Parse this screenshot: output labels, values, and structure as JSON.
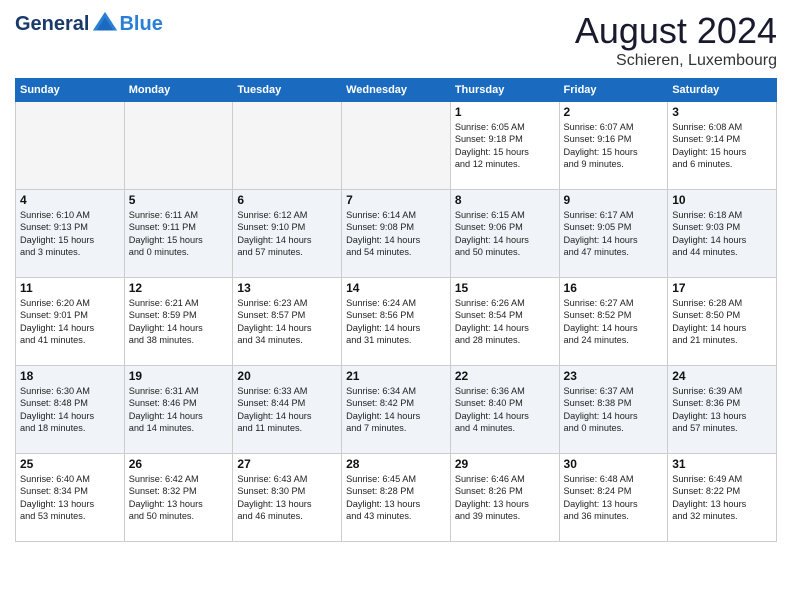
{
  "header": {
    "logo_general": "General",
    "logo_blue": "Blue",
    "main_title": "August 2024",
    "subtitle": "Schieren, Luxembourg"
  },
  "days_of_week": [
    "Sunday",
    "Monday",
    "Tuesday",
    "Wednesday",
    "Thursday",
    "Friday",
    "Saturday"
  ],
  "weeks": [
    [
      {
        "day": "",
        "info": ""
      },
      {
        "day": "",
        "info": ""
      },
      {
        "day": "",
        "info": ""
      },
      {
        "day": "",
        "info": ""
      },
      {
        "day": "1",
        "info": "Sunrise: 6:05 AM\nSunset: 9:18 PM\nDaylight: 15 hours\nand 12 minutes."
      },
      {
        "day": "2",
        "info": "Sunrise: 6:07 AM\nSunset: 9:16 PM\nDaylight: 15 hours\nand 9 minutes."
      },
      {
        "day": "3",
        "info": "Sunrise: 6:08 AM\nSunset: 9:14 PM\nDaylight: 15 hours\nand 6 minutes."
      }
    ],
    [
      {
        "day": "4",
        "info": "Sunrise: 6:10 AM\nSunset: 9:13 PM\nDaylight: 15 hours\nand 3 minutes."
      },
      {
        "day": "5",
        "info": "Sunrise: 6:11 AM\nSunset: 9:11 PM\nDaylight: 15 hours\nand 0 minutes."
      },
      {
        "day": "6",
        "info": "Sunrise: 6:12 AM\nSunset: 9:10 PM\nDaylight: 14 hours\nand 57 minutes."
      },
      {
        "day": "7",
        "info": "Sunrise: 6:14 AM\nSunset: 9:08 PM\nDaylight: 14 hours\nand 54 minutes."
      },
      {
        "day": "8",
        "info": "Sunrise: 6:15 AM\nSunset: 9:06 PM\nDaylight: 14 hours\nand 50 minutes."
      },
      {
        "day": "9",
        "info": "Sunrise: 6:17 AM\nSunset: 9:05 PM\nDaylight: 14 hours\nand 47 minutes."
      },
      {
        "day": "10",
        "info": "Sunrise: 6:18 AM\nSunset: 9:03 PM\nDaylight: 14 hours\nand 44 minutes."
      }
    ],
    [
      {
        "day": "11",
        "info": "Sunrise: 6:20 AM\nSunset: 9:01 PM\nDaylight: 14 hours\nand 41 minutes."
      },
      {
        "day": "12",
        "info": "Sunrise: 6:21 AM\nSunset: 8:59 PM\nDaylight: 14 hours\nand 38 minutes."
      },
      {
        "day": "13",
        "info": "Sunrise: 6:23 AM\nSunset: 8:57 PM\nDaylight: 14 hours\nand 34 minutes."
      },
      {
        "day": "14",
        "info": "Sunrise: 6:24 AM\nSunset: 8:56 PM\nDaylight: 14 hours\nand 31 minutes."
      },
      {
        "day": "15",
        "info": "Sunrise: 6:26 AM\nSunset: 8:54 PM\nDaylight: 14 hours\nand 28 minutes."
      },
      {
        "day": "16",
        "info": "Sunrise: 6:27 AM\nSunset: 8:52 PM\nDaylight: 14 hours\nand 24 minutes."
      },
      {
        "day": "17",
        "info": "Sunrise: 6:28 AM\nSunset: 8:50 PM\nDaylight: 14 hours\nand 21 minutes."
      }
    ],
    [
      {
        "day": "18",
        "info": "Sunrise: 6:30 AM\nSunset: 8:48 PM\nDaylight: 14 hours\nand 18 minutes."
      },
      {
        "day": "19",
        "info": "Sunrise: 6:31 AM\nSunset: 8:46 PM\nDaylight: 14 hours\nand 14 minutes."
      },
      {
        "day": "20",
        "info": "Sunrise: 6:33 AM\nSunset: 8:44 PM\nDaylight: 14 hours\nand 11 minutes."
      },
      {
        "day": "21",
        "info": "Sunrise: 6:34 AM\nSunset: 8:42 PM\nDaylight: 14 hours\nand 7 minutes."
      },
      {
        "day": "22",
        "info": "Sunrise: 6:36 AM\nSunset: 8:40 PM\nDaylight: 14 hours\nand 4 minutes."
      },
      {
        "day": "23",
        "info": "Sunrise: 6:37 AM\nSunset: 8:38 PM\nDaylight: 14 hours\nand 0 minutes."
      },
      {
        "day": "24",
        "info": "Sunrise: 6:39 AM\nSunset: 8:36 PM\nDaylight: 13 hours\nand 57 minutes."
      }
    ],
    [
      {
        "day": "25",
        "info": "Sunrise: 6:40 AM\nSunset: 8:34 PM\nDaylight: 13 hours\nand 53 minutes."
      },
      {
        "day": "26",
        "info": "Sunrise: 6:42 AM\nSunset: 8:32 PM\nDaylight: 13 hours\nand 50 minutes."
      },
      {
        "day": "27",
        "info": "Sunrise: 6:43 AM\nSunset: 8:30 PM\nDaylight: 13 hours\nand 46 minutes."
      },
      {
        "day": "28",
        "info": "Sunrise: 6:45 AM\nSunset: 8:28 PM\nDaylight: 13 hours\nand 43 minutes."
      },
      {
        "day": "29",
        "info": "Sunrise: 6:46 AM\nSunset: 8:26 PM\nDaylight: 13 hours\nand 39 minutes."
      },
      {
        "day": "30",
        "info": "Sunrise: 6:48 AM\nSunset: 8:24 PM\nDaylight: 13 hours\nand 36 minutes."
      },
      {
        "day": "31",
        "info": "Sunrise: 6:49 AM\nSunset: 8:22 PM\nDaylight: 13 hours\nand 32 minutes."
      }
    ]
  ]
}
